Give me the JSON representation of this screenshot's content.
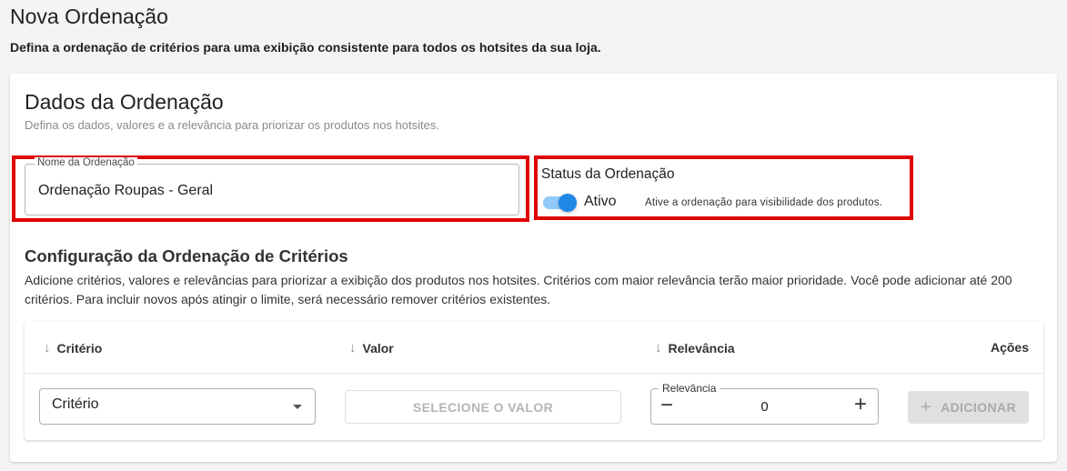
{
  "page": {
    "title": "Nova Ordenação",
    "subtitle": "Defina a ordenação de critérios para uma exibição consistente para todos os hotsites da sua loja."
  },
  "dados": {
    "title": "Dados da Ordenação",
    "subtitle": "Defina os dados, valores e a relevância para priorizar os produtos nos hotsites.",
    "name_field": {
      "label": "Nome da Ordenação",
      "value": "Ordenação Roupas - Geral"
    },
    "status": {
      "label": "Status da Ordenação",
      "switch_text": "Ativo",
      "checked": true,
      "hint": "Ative a ordenação para visibilidade dos produtos."
    }
  },
  "config": {
    "title": "Configuração da Ordenação de Critérios",
    "description": "Adicione critérios, valores e relevâncias para priorizar a exibição dos produtos nos hotsites. Critérios com maior relevância terão maior prioridade. Você pode adicionar até 200 critérios. Para incluir novos após atingir o limite, será necessário remover critérios existentes.",
    "table": {
      "headers": {
        "criterio": "Critério",
        "valor": "Valor",
        "relevancia": "Relevância",
        "acoes": "Ações"
      },
      "row": {
        "criterio_select": "Critério",
        "valor_button": "SELECIONE O VALOR",
        "relevancia_label": "Relevância",
        "relevancia_value": "0",
        "add_button": "ADICIONAR"
      }
    }
  },
  "icons": {
    "sort": "arrow-down-icon",
    "dropdown": "caret-down-icon",
    "minus": "minus-icon",
    "plus": "plus-icon"
  },
  "colors": {
    "highlight": "#e00000",
    "switch_thumb": "#1e88e5",
    "switch_track": "#90caf9"
  }
}
